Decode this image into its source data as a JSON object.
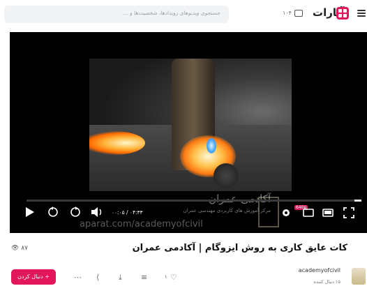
{
  "header": {
    "search_placeholder": "جستجوی ویدیوهای رویدادها، شخصیت‌ها و ...",
    "live_badge": "۱۰۴",
    "logo_text": "آپارات"
  },
  "player": {
    "time_display": "۰۰:۰۵ / ۰۴:۳۳",
    "quality_badge": "640p",
    "progress_fraction": 0.02,
    "watermark_title": "آکادمی عمران",
    "watermark_subtitle": "مرکز آموزش های کاربردی مهندسی عمران",
    "watermark_url": "aparat.com/academyofcivil"
  },
  "video": {
    "title": "کات عایق کاری به روش ایزوگام | آکادمی عمران",
    "views": "۸۷",
    "likes": "۱"
  },
  "channel": {
    "name": "academyofcivil",
    "followers": "۱۵ دنبال کننده",
    "follow_label": "+ دنبال کردن"
  },
  "colors": {
    "brand": "#e2175b"
  }
}
